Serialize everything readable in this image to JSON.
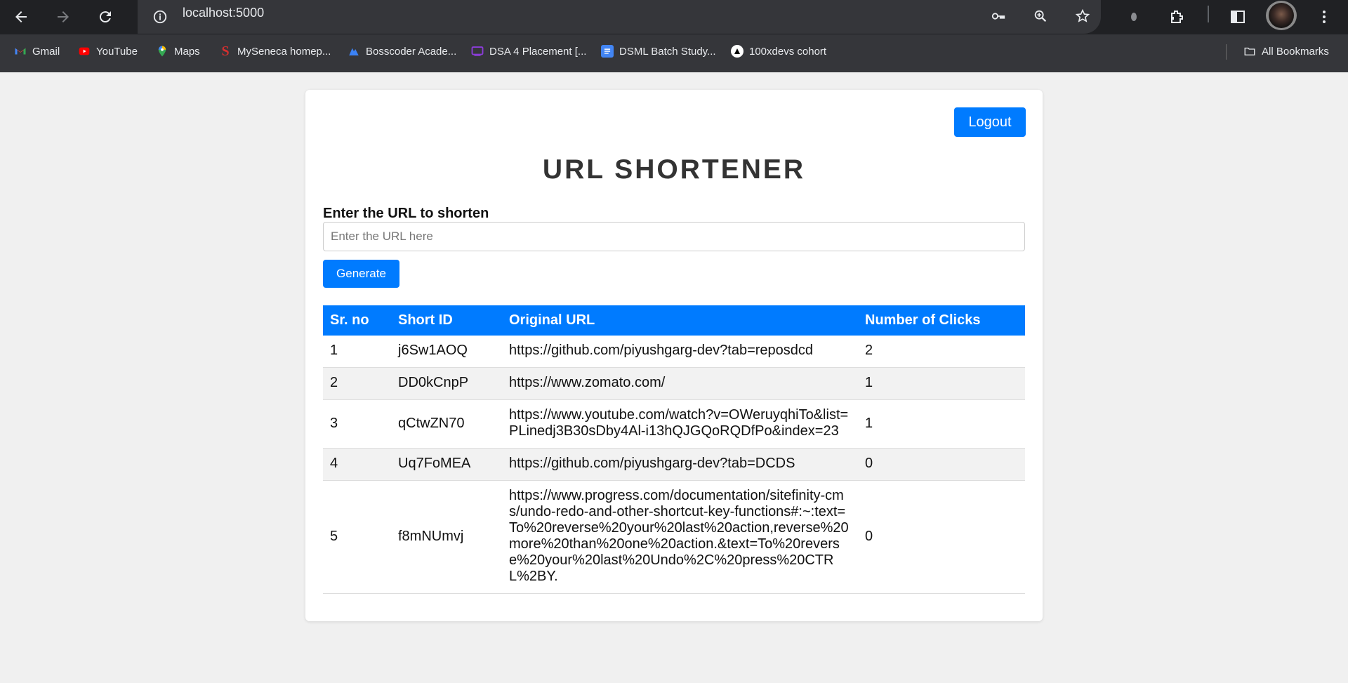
{
  "browser": {
    "address_url": "localhost:5000",
    "bookmarks": [
      {
        "label": "Gmail",
        "icon": "gmail-icon"
      },
      {
        "label": "YouTube",
        "icon": "youtube-icon"
      },
      {
        "label": "Maps",
        "icon": "maps-icon"
      },
      {
        "label": "MySeneca homep...",
        "icon": "seneca-icon"
      },
      {
        "label": "Bosscoder Acade...",
        "icon": "bosscoder-icon"
      },
      {
        "label": "DSA 4 Placement [...",
        "icon": "dsa-icon"
      },
      {
        "label": "DSML Batch Study...",
        "icon": "docs-icon"
      },
      {
        "label": "100xdevs cohort",
        "icon": "100xdevs-icon"
      }
    ],
    "all_bookmarks_label": "All Bookmarks"
  },
  "page": {
    "logout_label": "Logout",
    "title": "URL SHORTENER",
    "input_label": "Enter the URL to shorten",
    "input_placeholder": "Enter the URL here",
    "input_value": "",
    "generate_label": "Generate",
    "accent_color": "#007bff"
  },
  "table": {
    "headers": [
      "Sr. no",
      "Short ID",
      "Original URL",
      "Number of Clicks"
    ],
    "rows": [
      {
        "sr": "1",
        "short_id": "j6Sw1AOQ",
        "original_url": "https://github.com/piyushgarg-dev?tab=reposdcd",
        "clicks": "2"
      },
      {
        "sr": "2",
        "short_id": "DD0kCnpP",
        "original_url": "https://www.zomato.com/",
        "clicks": "1"
      },
      {
        "sr": "3",
        "short_id": "qCtwZN70",
        "original_url": "https://www.youtube.com/watch?v=OWeruyqhiTo&list=PLinedj3B30sDby4Al-i13hQJGQoRQDfPo&index=23",
        "clicks": "1"
      },
      {
        "sr": "4",
        "short_id": "Uq7FoMEA",
        "original_url": "https://github.com/piyushgarg-dev?tab=DCDS",
        "clicks": "0"
      },
      {
        "sr": "5",
        "short_id": "f8mNUmvj",
        "original_url": "https://www.progress.com/documentation/sitefinity-cms/undo-redo-and-other-shortcut-key-functions#:~:text=To%20reverse%20your%20last%20action,reverse%20more%20than%20one%20action.&text=To%20reverse%20your%20last%20Undo%2C%20press%20CTRL%2BY.",
        "clicks": "0"
      }
    ]
  }
}
